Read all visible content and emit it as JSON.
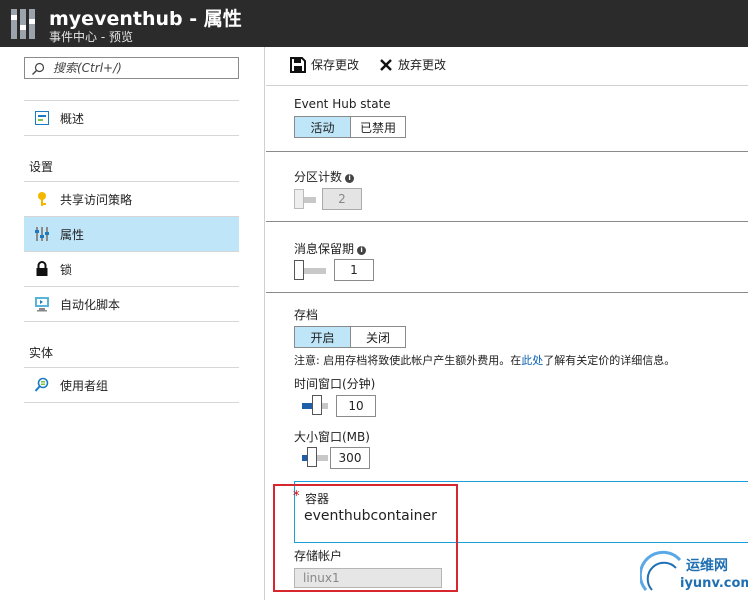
{
  "header": {
    "title": "myeventhub - 属性",
    "subtitle": "事件中心 - 预览"
  },
  "sidebar": {
    "search_placeholder": "搜索(Ctrl+/)",
    "overview": "概述",
    "settings_heading": "设置",
    "settings_items": [
      {
        "label": "共享访问策略",
        "icon": "key-icon"
      },
      {
        "label": "属性",
        "icon": "properties-icon",
        "active": true
      },
      {
        "label": "锁",
        "icon": "lock-icon"
      },
      {
        "label": "自动化脚本",
        "icon": "automation-script-icon"
      }
    ],
    "entities_heading": "实体",
    "entities_items": [
      {
        "label": "使用者组",
        "icon": "consumer-group-icon"
      }
    ]
  },
  "toolbar": {
    "save_label": "保存更改",
    "discard_label": "放弃更改"
  },
  "form": {
    "state": {
      "label": "Event Hub state",
      "options": [
        "活动",
        "已禁用"
      ],
      "selected": "活动"
    },
    "partition_count": {
      "label": "分区计数",
      "value": "2",
      "disabled": true
    },
    "retention": {
      "label": "消息保留期",
      "value": "1"
    },
    "archive": {
      "label": "存档",
      "options": [
        "开启",
        "关闭"
      ],
      "selected": "开启",
      "note_prefix": "注意: 启用存档将致使此帐户产生额外费用。在",
      "note_link": "此处",
      "note_suffix": "了解有关定价的详细信息。"
    },
    "time_window": {
      "label": "时间窗口(分钟)",
      "value": "10"
    },
    "size_window": {
      "label": "大小窗口(MB)",
      "value": "300"
    },
    "container": {
      "required_mark": "*",
      "label": "容器",
      "value": "eventhubcontainer"
    },
    "storage_account": {
      "label": "存储帐户",
      "value": "linux1"
    }
  },
  "watermark": {
    "line1": "运维网",
    "line2": "iyunv.com"
  },
  "colors": {
    "accent": "#1aa0d8",
    "active_bg": "#bfe6f8",
    "slider_fill": "#1f5fa8",
    "highlight": "#d6262e",
    "titlebar": "#2b2b2b"
  }
}
